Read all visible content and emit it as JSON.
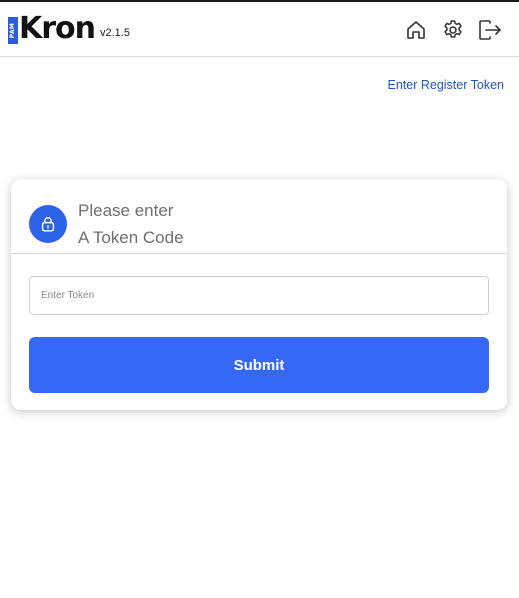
{
  "header": {
    "logo_badge_text": "PAM",
    "logo_text": "Kron",
    "version": "v2.1.5",
    "icons": [
      "home-icon",
      "gear-icon",
      "logout-icon"
    ]
  },
  "register_link": "Enter Register Token",
  "card": {
    "icon": "lock-icon",
    "title_line1": "Please enter",
    "title_line2": "A Token Code",
    "token_placeholder": "Enter Token",
    "token_value": "",
    "submit_label": "Submit"
  },
  "colors": {
    "accent": "#3468f5",
    "link": "#2255c9",
    "logo_badge": "#2e5bd6"
  }
}
